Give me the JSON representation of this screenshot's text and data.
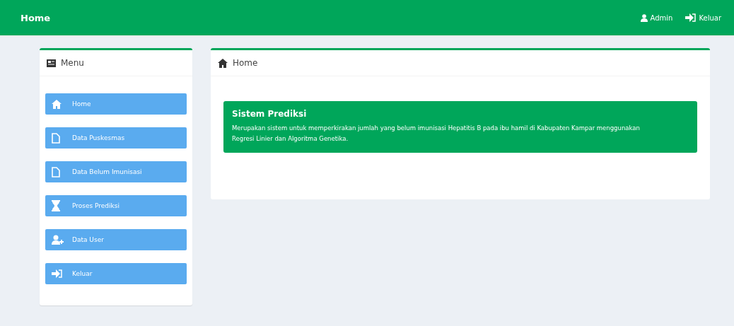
{
  "topbar": {
    "title": "Home",
    "links": [
      {
        "label": "Admin"
      },
      {
        "label": "Keluar"
      }
    ]
  },
  "sidebar": {
    "title": "Menu",
    "items": [
      {
        "label": "Home"
      },
      {
        "label": "Data Puskesmas"
      },
      {
        "label": "Data Belum Imunisasi"
      },
      {
        "label": "Proses Prediksi"
      },
      {
        "label": "Data User"
      },
      {
        "label": "Keluar"
      }
    ]
  },
  "content": {
    "title": "Home",
    "alert": {
      "title": "Sistem Prediksi",
      "text": "Merupakan sistem untuk memperkirakan jumlah yang belum imunisasi Hepatitis B pada ibu hamil di Kabupaten Kampar menggunakan Regresi Linier dan Algoritma Genetika."
    }
  }
}
